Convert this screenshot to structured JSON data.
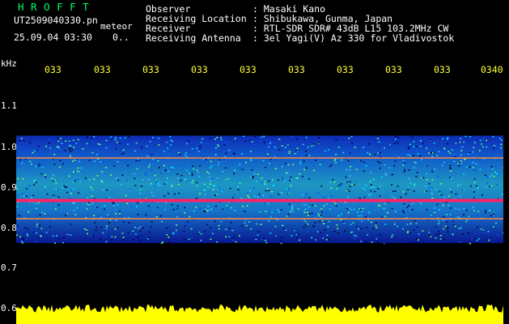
{
  "app": {
    "brand": "HROFFT",
    "file_name": "UT2509040330.pn",
    "mode": "meteor",
    "timestamp": "25.09.04 03:30",
    "counter": "0.."
  },
  "meta": [
    {
      "label": "Observer",
      "value": ": Masaki Kano"
    },
    {
      "label": "Receiving Location",
      "value": ": Shibukawa, Gunma, Japan"
    },
    {
      "label": "Receiver",
      "value": ": RTL-SDR SDR# 43dB L15 103.2MHz CW"
    },
    {
      "label": "Receiving Antenna",
      "value": ": 3el Yagi(V) Az 330 for Vladivostok"
    }
  ],
  "axis": {
    "unit": "kHz",
    "x_ticks": [
      "033",
      "033",
      "033",
      "033",
      "033",
      "033",
      "033",
      "033",
      "033",
      "0340"
    ],
    "y_ticks": [
      "1.1",
      "1.0",
      "0.9",
      "0.8",
      "0.7",
      "0.6"
    ]
  },
  "colors": {
    "text": "#ffffff",
    "brand": "#00ff66",
    "tick_x": "#ffff33",
    "carrier": "#ff2266",
    "noise_floor": "#ffff00",
    "background": "#000000"
  },
  "chart_data": {
    "type": "heatmap",
    "ylabel": "kHz",
    "ylim": [
      0.6,
      1.1
    ],
    "signal_band_khz": [
      0.76,
      1.025
    ],
    "carrier_lines_khz": [
      0.97,
      0.865,
      0.82
    ],
    "x_tick_labels": [
      "033",
      "033",
      "033",
      "033",
      "033",
      "033",
      "033",
      "033",
      "033",
      "0340"
    ],
    "y_tick_labels": [
      "1.1",
      "1.0",
      "0.9",
      "0.8",
      "0.7",
      "0.6"
    ]
  }
}
